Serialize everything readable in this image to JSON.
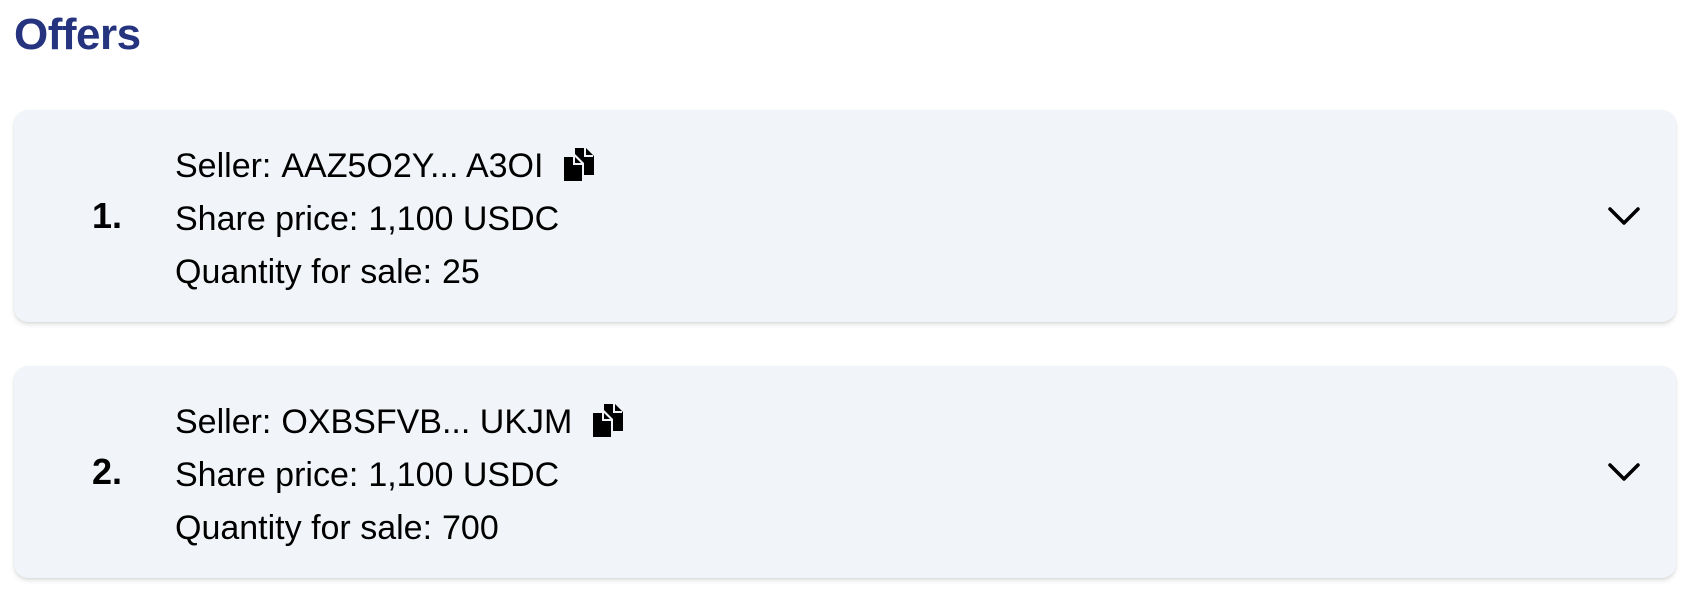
{
  "section": {
    "title": "Offers"
  },
  "labels": {
    "seller": "Seller:",
    "share_price": "Share price:",
    "quantity": "Quantity for sale:"
  },
  "icons": {
    "copy": "copy-icon",
    "expand": "chevron-down-icon"
  },
  "colors": {
    "title": "#26347f",
    "card_background": "#f1f4f9"
  },
  "offers": [
    {
      "index": "1.",
      "seller": "AAZ5O2Y... A3OI",
      "share_price": "1,100 USDC",
      "quantity": "25"
    },
    {
      "index": "2.",
      "seller": "OXBSFVB... UKJM",
      "share_price": "1,100 USDC",
      "quantity": "700"
    }
  ]
}
